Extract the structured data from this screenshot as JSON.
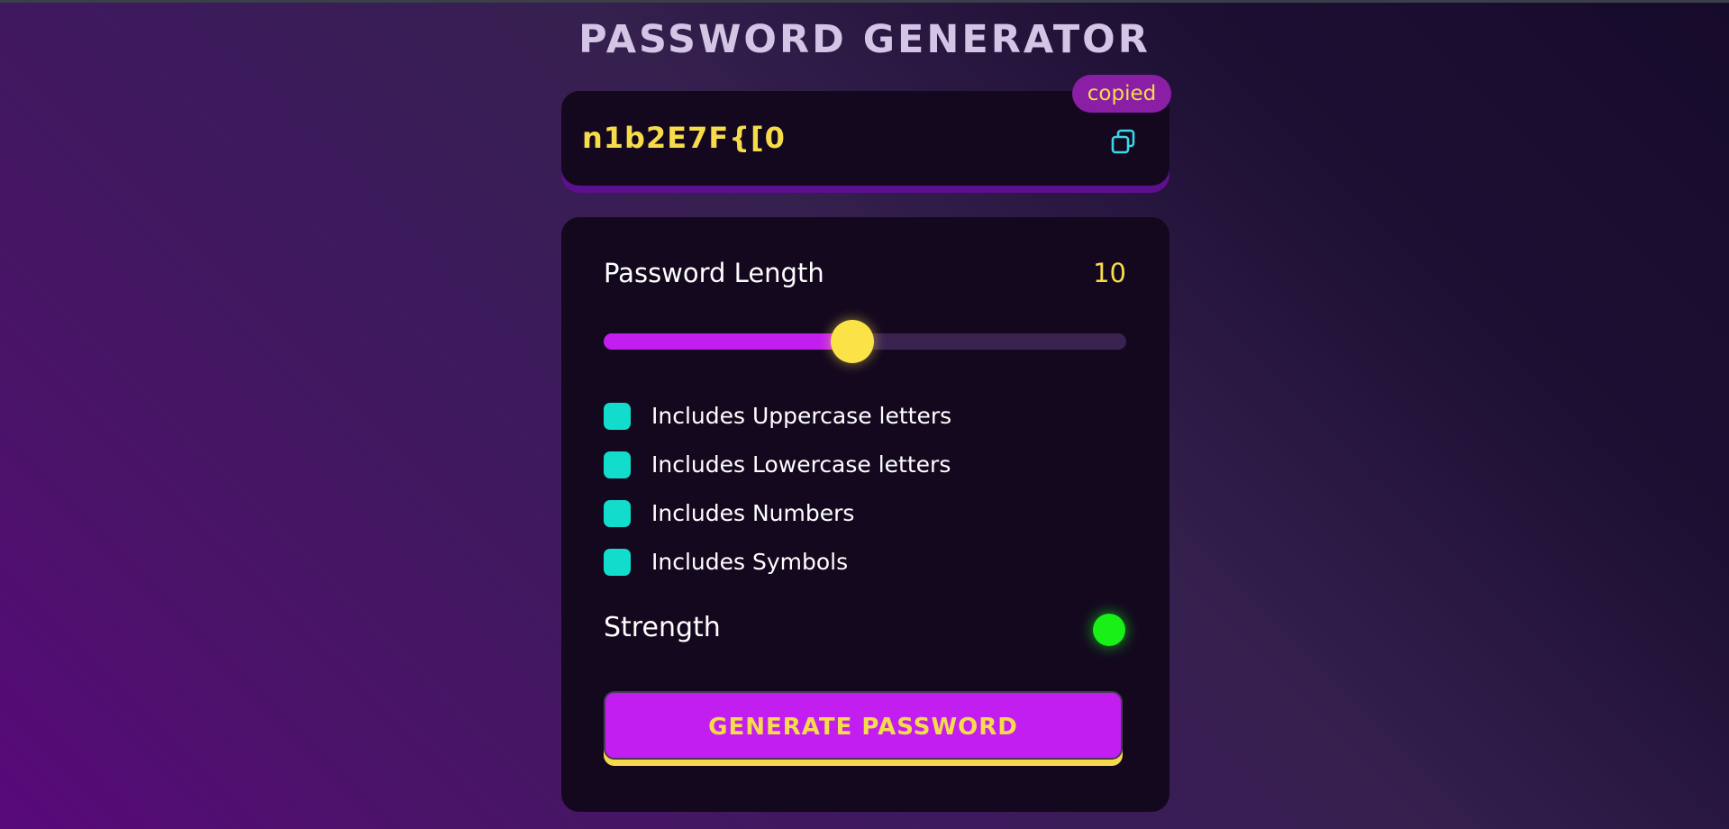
{
  "app": {
    "title": "PASSWORD GENERATOR"
  },
  "display": {
    "password": "n1b2E7F{[0",
    "copied_badge": "copied",
    "copy_icon": "copy-icon"
  },
  "length": {
    "label": "Password Length",
    "value": "10",
    "slider_fraction": 0.475
  },
  "options": [
    {
      "label": "Includes Uppercase letters",
      "checked": true
    },
    {
      "label": "Includes Lowercase letters",
      "checked": true
    },
    {
      "label": "Includes Numbers",
      "checked": true
    },
    {
      "label": "Includes Symbols",
      "checked": true
    }
  ],
  "strength": {
    "label": "Strength",
    "indicator_color": "#18f018"
  },
  "generate": {
    "label": "GENERATE PASSWORD"
  },
  "colors": {
    "accent_purple": "#c21ef0",
    "accent_yellow": "#f6dc4b",
    "checkbox_teal": "#12dccb",
    "card_bg": "#14081f"
  }
}
